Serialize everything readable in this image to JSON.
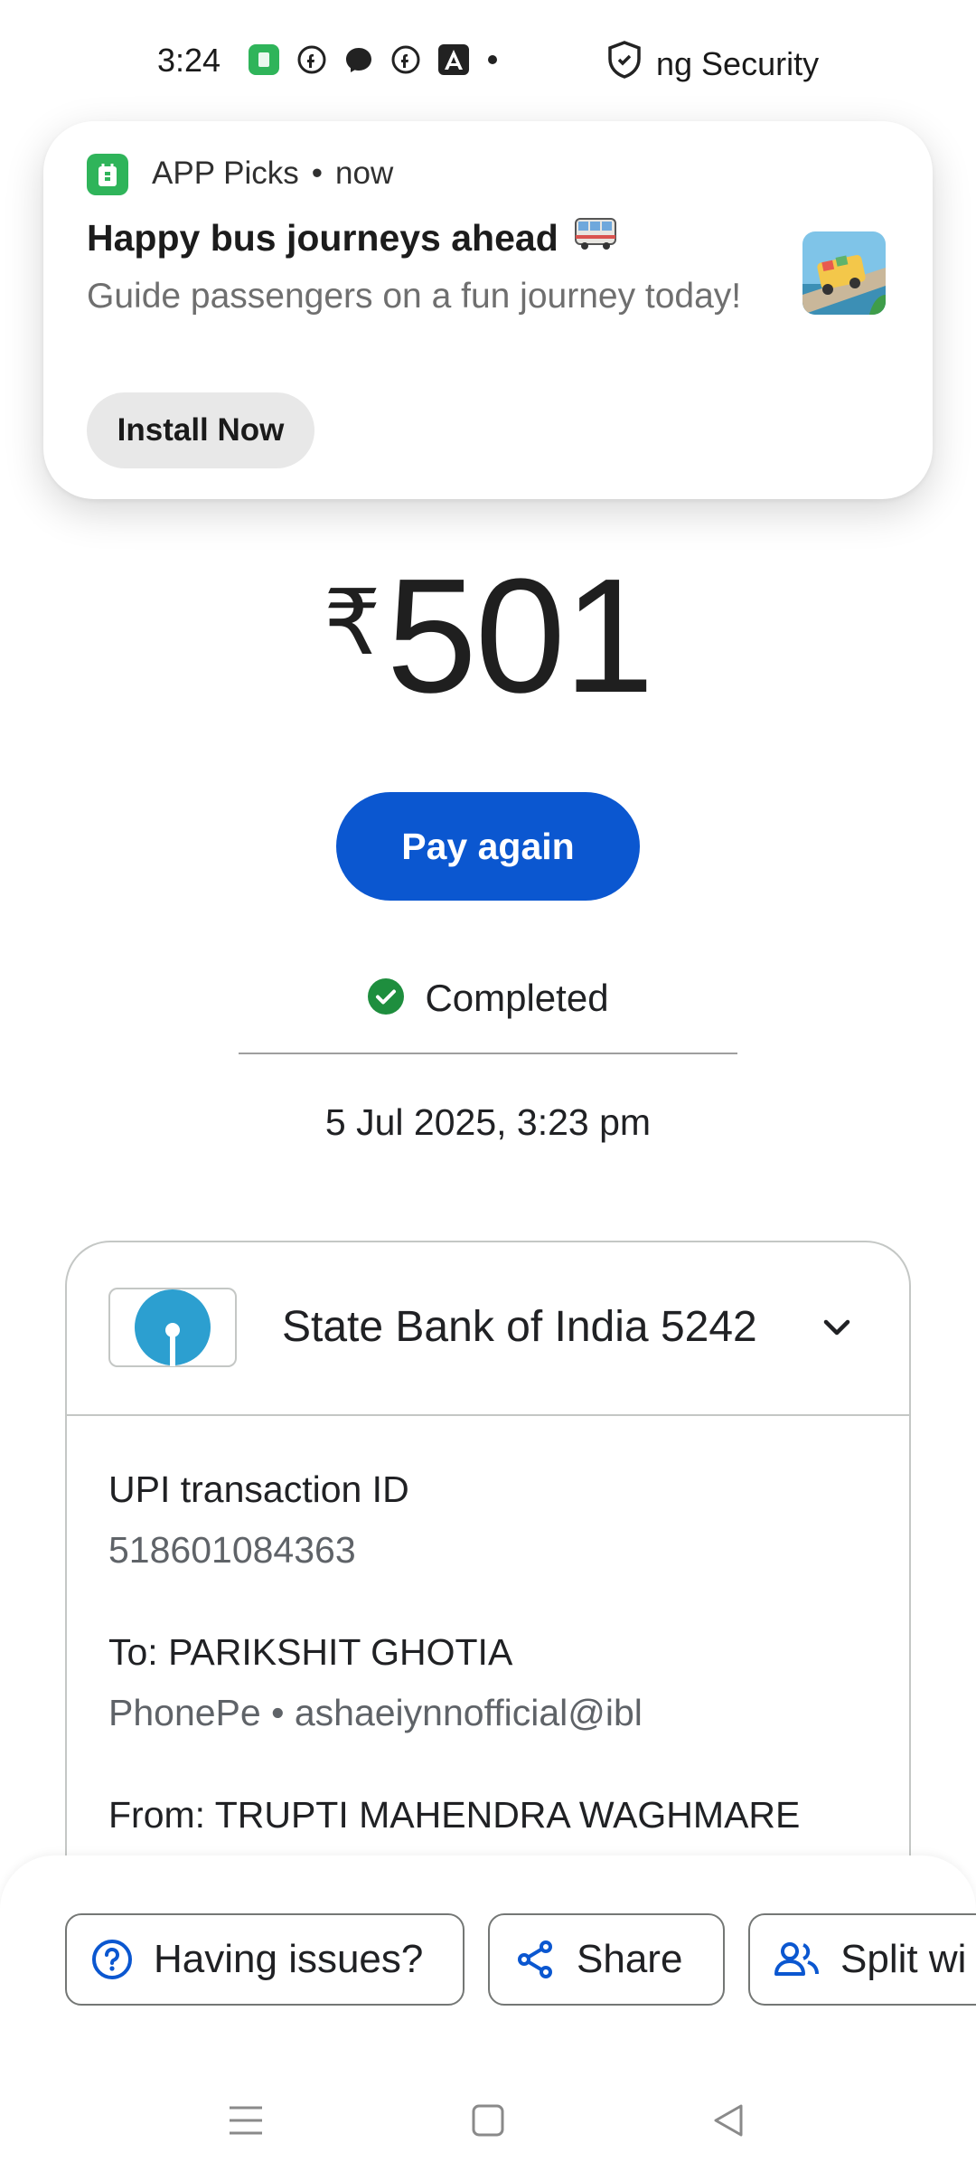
{
  "status_bar": {
    "time": "3:24",
    "security_text": "ng Security"
  },
  "notification": {
    "app_name": "APP Picks",
    "separator": "•",
    "time": "now",
    "title": "Happy bus journeys ahead",
    "body": "Guide passengers on a fun journey today!",
    "action_label": "Install Now"
  },
  "payment": {
    "currency_symbol": "₹",
    "amount": "501",
    "pay_again_label": "Pay again",
    "status": "Completed",
    "datetime": "5 Jul 2025, 3:23 pm"
  },
  "details": {
    "bank_name": "State Bank of India 5242",
    "upi_label": "UPI transaction ID",
    "upi_id": "518601084363",
    "to_label": "To: PARIKSHIT GHOTIA",
    "to_sub": "PhonePe • ashaeiynnofficial@ibl",
    "from_label": "From: TRUPTI MAHENDRA  WAGHMARE"
  },
  "actions": {
    "issues_label": "Having issues?",
    "share_label": "Share",
    "split_label": "Split wi"
  },
  "colors": {
    "primary": "#0b57d0",
    "success": "#1e8e3e",
    "sbi": "#2c9fd0",
    "notif_app": "#2fb45a"
  }
}
